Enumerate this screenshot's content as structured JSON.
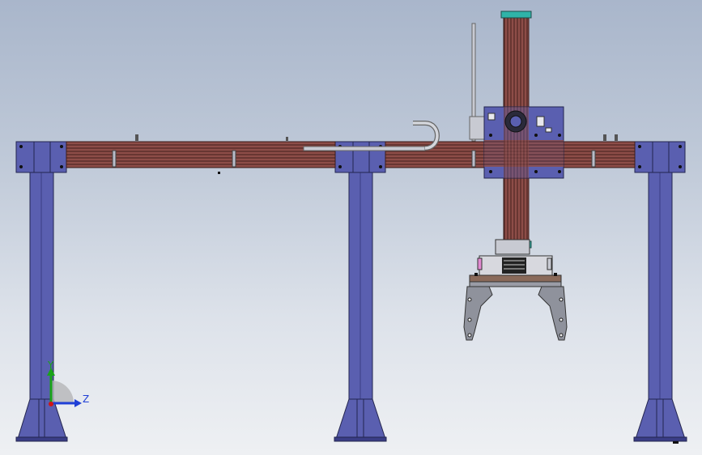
{
  "viewport": {
    "background_top": "#a9b6cb",
    "background_bottom": "#eef0f3"
  },
  "colors": {
    "frame_blue": "#5a5fb0",
    "frame_blue_dark": "#2f3170",
    "beam_red": "#8a4a46",
    "beam_red_dark": "#4a2422",
    "steel_gray": "#b9bcc8",
    "teal_cap": "#2fb3a8"
  },
  "triad": {
    "y_label": "Y",
    "z_label": "Z",
    "y_color": "#19a319",
    "z_color": "#1f3fd6",
    "origin_color": "#d01515"
  }
}
